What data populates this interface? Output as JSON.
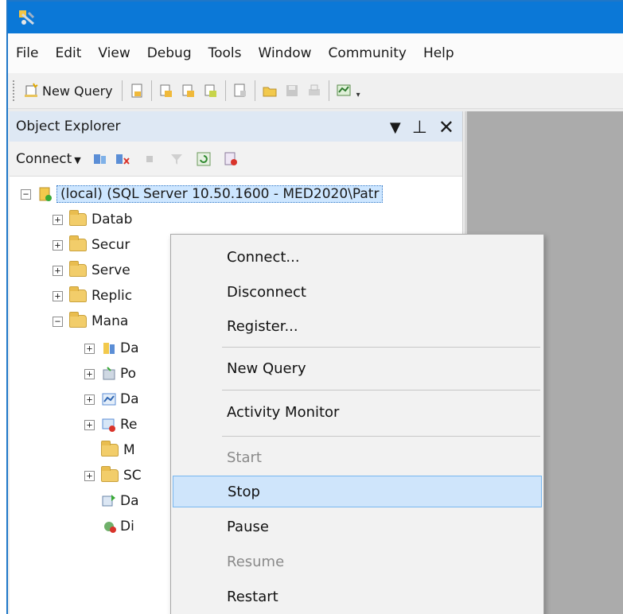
{
  "menubar": {
    "items": [
      "File",
      "Edit",
      "View",
      "Debug",
      "Tools",
      "Window",
      "Community",
      "Help"
    ]
  },
  "toolbar": {
    "new_query_label": "New Query"
  },
  "object_explorer": {
    "title": "Object Explorer",
    "connect_label": "Connect",
    "server_node": "(local) (SQL Server 10.50.1600 - MED2020\\Patr",
    "nodes": [
      "Datab",
      "Secur",
      "Serve",
      "Replic",
      "Mana"
    ],
    "sub_nodes": [
      "Da",
      "Po",
      "Da",
      "Re",
      "M",
      "SC",
      "Da",
      "Di"
    ]
  },
  "context_menu": {
    "items": [
      {
        "label": "Connect...",
        "enabled": true
      },
      {
        "label": "Disconnect",
        "enabled": true
      },
      {
        "label": "Register...",
        "enabled": true
      },
      {
        "label": "New Query",
        "enabled": true
      },
      {
        "label": "Activity Monitor",
        "enabled": true
      },
      {
        "label": "Start",
        "enabled": false
      },
      {
        "label": "Stop",
        "enabled": true,
        "highlighted": true
      },
      {
        "label": "Pause",
        "enabled": true
      },
      {
        "label": "Resume",
        "enabled": false
      },
      {
        "label": "Restart",
        "enabled": true
      }
    ]
  },
  "colors": {
    "titlebar": "#0b78d7",
    "selection": "#cde6ff",
    "menu_hover": "#cfe5fb"
  }
}
